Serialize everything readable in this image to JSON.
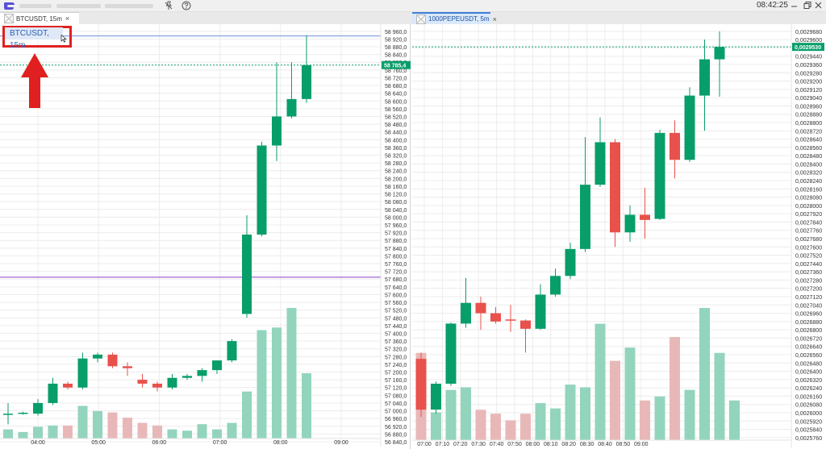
{
  "window": {
    "clock": "08:42:25",
    "accent": "#3d7fd9"
  },
  "tabs": [
    {
      "label": "BTCUSDT, 15m",
      "close": "×"
    },
    {
      "label": "1000PEPEUSDT, 5m",
      "close": "×"
    }
  ],
  "icons": [
    "app-logo-icon",
    "pin-off-icon",
    "help-icon",
    "minimize-icon",
    "restore-icon",
    "close-icon",
    "chart-tab-icon",
    "cursor-icon",
    "arrow-up-icon"
  ],
  "colors": {
    "up": "#089e69",
    "down": "#e8514c",
    "vol_up": "#93d4bd",
    "vol_down": "#e8b8b8",
    "grid": "#ececec",
    "price_line_hi": "#6b8ed6",
    "level_line": "#8a3ec9",
    "annotation": "#e02020"
  },
  "chart_data": [
    {
      "type": "candlestick",
      "title": "BTCUSDT, 15m",
      "ylim": [
        56840,
        58980
      ],
      "y_ticks": [
        "58 960,0",
        "58 920,0",
        "58 880,0",
        "58 840,0",
        "58 800,0",
        "58 760,0",
        "58 720,0",
        "58 680,0",
        "58 640,0",
        "58 600,0",
        "58 560,0",
        "58 520,0",
        "58 480,0",
        "58 440,0",
        "58 400,0",
        "58 360,0",
        "58 320,0",
        "58 280,0",
        "58 240,0",
        "58 200,0",
        "58 160,0",
        "58 120,0",
        "58 080,0",
        "58 040,0",
        "58 000,0",
        "57 960,0",
        "57 920,0",
        "57 880,0",
        "57 840,0",
        "57 800,0",
        "57 760,0",
        "57 720,0",
        "57 680,0",
        "57 640,0",
        "57 600,0",
        "57 560,0",
        "57 520,0",
        "57 480,0",
        "57 440,0",
        "57 400,0",
        "57 360,0",
        "57 320,0",
        "57 280,0",
        "57 240,0",
        "57 200,0",
        "57 160,0",
        "57 120,0",
        "57 080,0",
        "57 040,0",
        "57 000,0",
        "56 960,0",
        "56 920,0",
        "56 880,0",
        "56 840,0"
      ],
      "x_ticks": [
        "04:00",
        "05:00",
        "06:00",
        "07:00",
        "08:00",
        "09:00"
      ],
      "price_tag": {
        "label": "58 785,4",
        "value": 58785.4,
        "color": "#089e69"
      },
      "lines": [
        {
          "name": "high-line",
          "value": 58936,
          "color": "#6b8ed6"
        },
        {
          "name": "support-line",
          "value": 57690,
          "color": "#8a3ec9"
        }
      ],
      "candles": [
        {
          "t": "03:30",
          "o": 56980,
          "h": 57040,
          "l": 56930,
          "c": 56985
        },
        {
          "t": "03:45",
          "o": 56985,
          "h": 56995,
          "l": 56980,
          "c": 56990
        },
        {
          "t": "04:00",
          "o": 56985,
          "h": 57060,
          "l": 56975,
          "c": 57040
        },
        {
          "t": "04:15",
          "o": 57040,
          "h": 57170,
          "l": 57030,
          "c": 57140
        },
        {
          "t": "04:30",
          "o": 57140,
          "h": 57150,
          "l": 57110,
          "c": 57120
        },
        {
          "t": "04:45",
          "o": 57120,
          "h": 57300,
          "l": 57110,
          "c": 57270
        },
        {
          "t": "05:00",
          "o": 57270,
          "h": 57300,
          "l": 57250,
          "c": 57290
        },
        {
          "t": "05:15",
          "o": 57290,
          "h": 57300,
          "l": 57220,
          "c": 57230
        },
        {
          "t": "05:30",
          "o": 57230,
          "h": 57250,
          "l": 57180,
          "c": 57220
        },
        {
          "t": "05:45",
          "o": 57160,
          "h": 57190,
          "l": 57120,
          "c": 57140
        },
        {
          "t": "06:00",
          "o": 57140,
          "h": 57150,
          "l": 57100,
          "c": 57120
        },
        {
          "t": "06:15",
          "o": 57120,
          "h": 57190,
          "l": 57110,
          "c": 57170
        },
        {
          "t": "06:30",
          "o": 57170,
          "h": 57190,
          "l": 57160,
          "c": 57180
        },
        {
          "t": "06:45",
          "o": 57180,
          "h": 57220,
          "l": 57150,
          "c": 57210
        },
        {
          "t": "07:00",
          "o": 57210,
          "h": 57260,
          "l": 57190,
          "c": 57260
        },
        {
          "t": "07:15",
          "o": 57260,
          "h": 57370,
          "l": 57250,
          "c": 57360
        },
        {
          "t": "07:30",
          "o": 57500,
          "h": 58010,
          "l": 57480,
          "c": 57910
        },
        {
          "t": "07:45",
          "o": 57910,
          "h": 58390,
          "l": 57900,
          "c": 58370
        },
        {
          "t": "08:00",
          "o": 58370,
          "h": 58800,
          "l": 58290,
          "c": 58520
        },
        {
          "t": "08:15",
          "o": 58520,
          "h": 58800,
          "l": 58510,
          "c": 58610
        },
        {
          "t": "08:30",
          "o": 58610,
          "h": 58940,
          "l": 58590,
          "c": 58785
        }
      ],
      "volume": {
        "max": 100,
        "values": [
          7,
          5,
          9,
          10,
          10,
          25,
          21,
          20,
          16,
          12,
          10,
          7,
          6,
          11,
          7,
          12,
          36,
          83,
          85,
          100,
          50
        ]
      }
    },
    {
      "type": "candlestick",
      "title": "1000PEPEUSDT, 5m",
      "ylim": [
        0.002572,
        0.002971
      ],
      "y_ticks": [
        "0,0029680",
        "0,0029600",
        "0,0029520",
        "0,0029440",
        "0,0029360",
        "0,0029280",
        "0,0029200",
        "0,0029120",
        "0,0029040",
        "0,0028960",
        "0,0028880",
        "0,0028800",
        "0,0028720",
        "0,0028640",
        "0,0028560",
        "0,0028480",
        "0,0028400",
        "0,0028320",
        "0,0028240",
        "0,0028160",
        "0,0028080",
        "0,0028000",
        "0,0027920",
        "0,0027840",
        "0,0027760",
        "0,0027680",
        "0,0027600",
        "0,0027520",
        "0,0027440",
        "0,0027360",
        "0,0027280",
        "0,0027200",
        "0,0027120",
        "0,0027040",
        "0,0026960",
        "0,0026880",
        "0,0026800",
        "0,0026720",
        "0,0026640",
        "0,0026560",
        "0,0026480",
        "0,0026400",
        "0,0026320",
        "0,0026240",
        "0,0026160",
        "0,0026080",
        "0,0026000",
        "0,0025920",
        "0,0025840",
        "0,0025760"
      ],
      "x_ticks": [
        "07:00",
        "07:10",
        "07:20",
        "07:30",
        "07:40",
        "07:50",
        "08:00",
        "08:10",
        "08:20",
        "08:30",
        "08:40",
        "08:50",
        "09:00"
      ],
      "price_tag": {
        "label": "0,0029530",
        "value": 0.002953,
        "color": "#089e69"
      },
      "lines": [],
      "candles": [
        {
          "t": "07:00",
          "o": 0.002652,
          "h": 0.002658,
          "l": 0.002596,
          "c": 0.002603
        },
        {
          "t": "07:05",
          "o": 0.002603,
          "h": 0.00263,
          "l": 0.002599,
          "c": 0.002628
        },
        {
          "t": "07:10",
          "o": 0.002628,
          "h": 0.002687,
          "l": 0.002626,
          "c": 0.002686
        },
        {
          "t": "07:15",
          "o": 0.002686,
          "h": 0.00273,
          "l": 0.002682,
          "c": 0.002706
        },
        {
          "t": "07:20",
          "o": 0.002706,
          "h": 0.002712,
          "l": 0.00268,
          "c": 0.002696
        },
        {
          "t": "07:25",
          "o": 0.002696,
          "h": 0.002702,
          "l": 0.002686,
          "c": 0.002688
        },
        {
          "t": "07:30",
          "o": 0.00269,
          "h": 0.002704,
          "l": 0.002678,
          "c": 0.002689
        },
        {
          "t": "07:35",
          "o": 0.002689,
          "h": 0.00269,
          "l": 0.002658,
          "c": 0.002681
        },
        {
          "t": "07:40",
          "o": 0.002681,
          "h": 0.002724,
          "l": 0.00268,
          "c": 0.002714
        },
        {
          "t": "07:45",
          "o": 0.002714,
          "h": 0.002739,
          "l": 0.002712,
          "c": 0.002732
        },
        {
          "t": "07:50",
          "o": 0.002732,
          "h": 0.002764,
          "l": 0.002729,
          "c": 0.002758
        },
        {
          "t": "07:55",
          "o": 0.002758,
          "h": 0.002866,
          "l": 0.002755,
          "c": 0.00282
        },
        {
          "t": "08:00",
          "o": 0.00282,
          "h": 0.002885,
          "l": 0.002818,
          "c": 0.002861
        },
        {
          "t": "08:05",
          "o": 0.002861,
          "h": 0.002864,
          "l": 0.00276,
          "c": 0.002774
        },
        {
          "t": "08:10",
          "o": 0.002774,
          "h": 0.0028,
          "l": 0.002765,
          "c": 0.002791
        },
        {
          "t": "08:15",
          "o": 0.002791,
          "h": 0.002817,
          "l": 0.002768,
          "c": 0.002786
        },
        {
          "t": "08:20",
          "o": 0.002787,
          "h": 0.002873,
          "l": 0.002786,
          "c": 0.00287
        },
        {
          "t": "08:25",
          "o": 0.00287,
          "h": 0.002882,
          "l": 0.002826,
          "c": 0.002844
        },
        {
          "t": "08:30",
          "o": 0.002844,
          "h": 0.002914,
          "l": 0.002842,
          "c": 0.002906
        },
        {
          "t": "08:35",
          "o": 0.002906,
          "h": 0.00296,
          "l": 0.002872,
          "c": 0.002941
        },
        {
          "t": "08:40",
          "o": 0.002941,
          "h": 0.002968,
          "l": 0.002905,
          "c": 0.002953
        }
      ],
      "volume": {
        "max": 100,
        "values": [
          66,
          21,
          38,
          40,
          23,
          20,
          15,
          20,
          28,
          24,
          42,
          40,
          88,
          60,
          70,
          30,
          33,
          78,
          38,
          100,
          66,
          30
        ]
      }
    }
  ]
}
